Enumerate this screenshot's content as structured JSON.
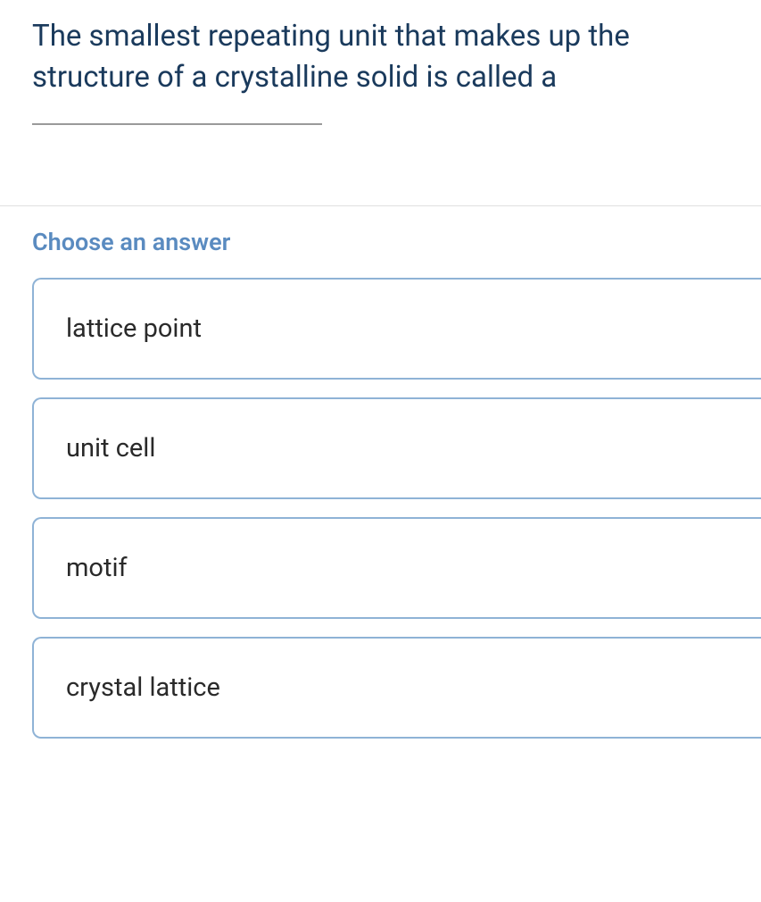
{
  "question": {
    "text": "The smallest repeating unit that makes up the structure of a crystalline solid is called a"
  },
  "prompt": "Choose an answer",
  "options": [
    {
      "label": "lattice point"
    },
    {
      "label": "unit cell"
    },
    {
      "label": "motif"
    },
    {
      "label": "crystal lattice"
    }
  ]
}
